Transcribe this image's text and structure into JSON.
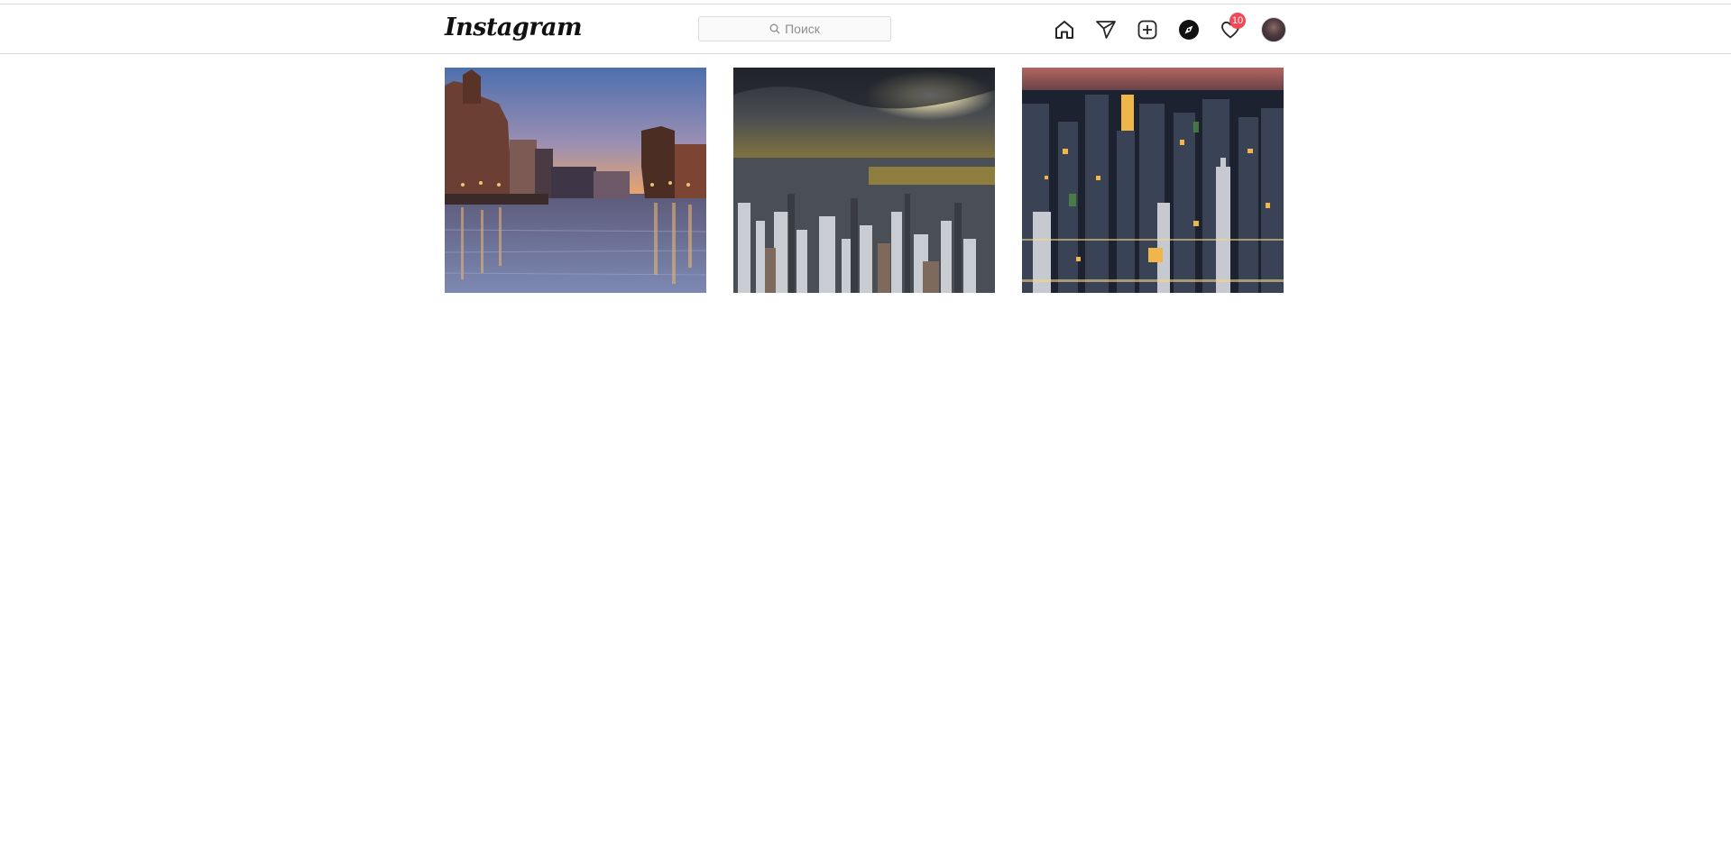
{
  "header": {
    "logo_text": "Instagram",
    "search": {
      "placeholder": "Поиск",
      "value": ""
    },
    "notifications_count": "10"
  },
  "nav": [
    {
      "icon": "home-icon"
    },
    {
      "icon": "direct-send-icon"
    },
    {
      "icon": "new-post-icon"
    },
    {
      "icon": "explore-compass-icon"
    },
    {
      "icon": "activity-heart-icon"
    },
    {
      "icon": "profile-avatar"
    }
  ],
  "posts": [
    {
      "subject": "harbor waterfront at dusk"
    },
    {
      "subject": "city under stormy sky"
    },
    {
      "subject": "city skyline at night"
    }
  ],
  "colors": {
    "badge": "#ed4956",
    "border": "#dbdbdb",
    "text_muted": "#8e8e8e"
  }
}
